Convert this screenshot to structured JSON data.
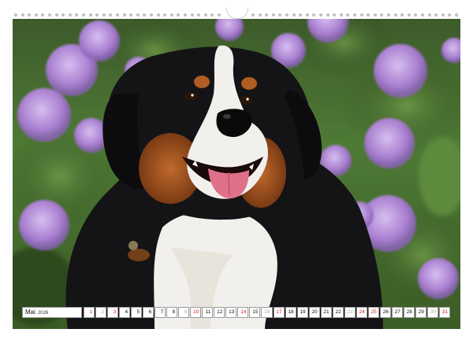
{
  "calendar": {
    "month": "Mai",
    "year": "2026",
    "days": [
      {
        "n": "1",
        "style": "red"
      },
      {
        "n": "2",
        "style": "grey"
      },
      {
        "n": "3",
        "style": "red"
      },
      {
        "n": "4",
        "style": ""
      },
      {
        "n": "5",
        "style": ""
      },
      {
        "n": "6",
        "style": ""
      },
      {
        "n": "7",
        "style": ""
      },
      {
        "n": "8",
        "style": ""
      },
      {
        "n": "9",
        "style": "grey"
      },
      {
        "n": "10",
        "style": "red"
      },
      {
        "n": "11",
        "style": ""
      },
      {
        "n": "12",
        "style": ""
      },
      {
        "n": "13",
        "style": ""
      },
      {
        "n": "14",
        "style": "red"
      },
      {
        "n": "15",
        "style": ""
      },
      {
        "n": "16",
        "style": "grey"
      },
      {
        "n": "17",
        "style": "red"
      },
      {
        "n": "18",
        "style": ""
      },
      {
        "n": "19",
        "style": ""
      },
      {
        "n": "20",
        "style": ""
      },
      {
        "n": "21",
        "style": ""
      },
      {
        "n": "22",
        "style": ""
      },
      {
        "n": "23",
        "style": "grey"
      },
      {
        "n": "24",
        "style": "red"
      },
      {
        "n": "25",
        "style": "red"
      },
      {
        "n": "26",
        "style": ""
      },
      {
        "n": "27",
        "style": ""
      },
      {
        "n": "28",
        "style": ""
      },
      {
        "n": "29",
        "style": ""
      },
      {
        "n": "30",
        "style": "grey"
      },
      {
        "n": "31",
        "style": "red"
      }
    ]
  },
  "photo": {
    "subject_icon": "bernese-mountain-dog-illustration",
    "background_icon": "purple-hydrangea-flowers",
    "colors": {
      "fur_black": "#141416",
      "fur_tan": "#a4521f",
      "fur_white": "#f2f0ec",
      "tongue": "#e0708a",
      "flower": "#b992d6",
      "leaf": "#4f7d34"
    }
  }
}
